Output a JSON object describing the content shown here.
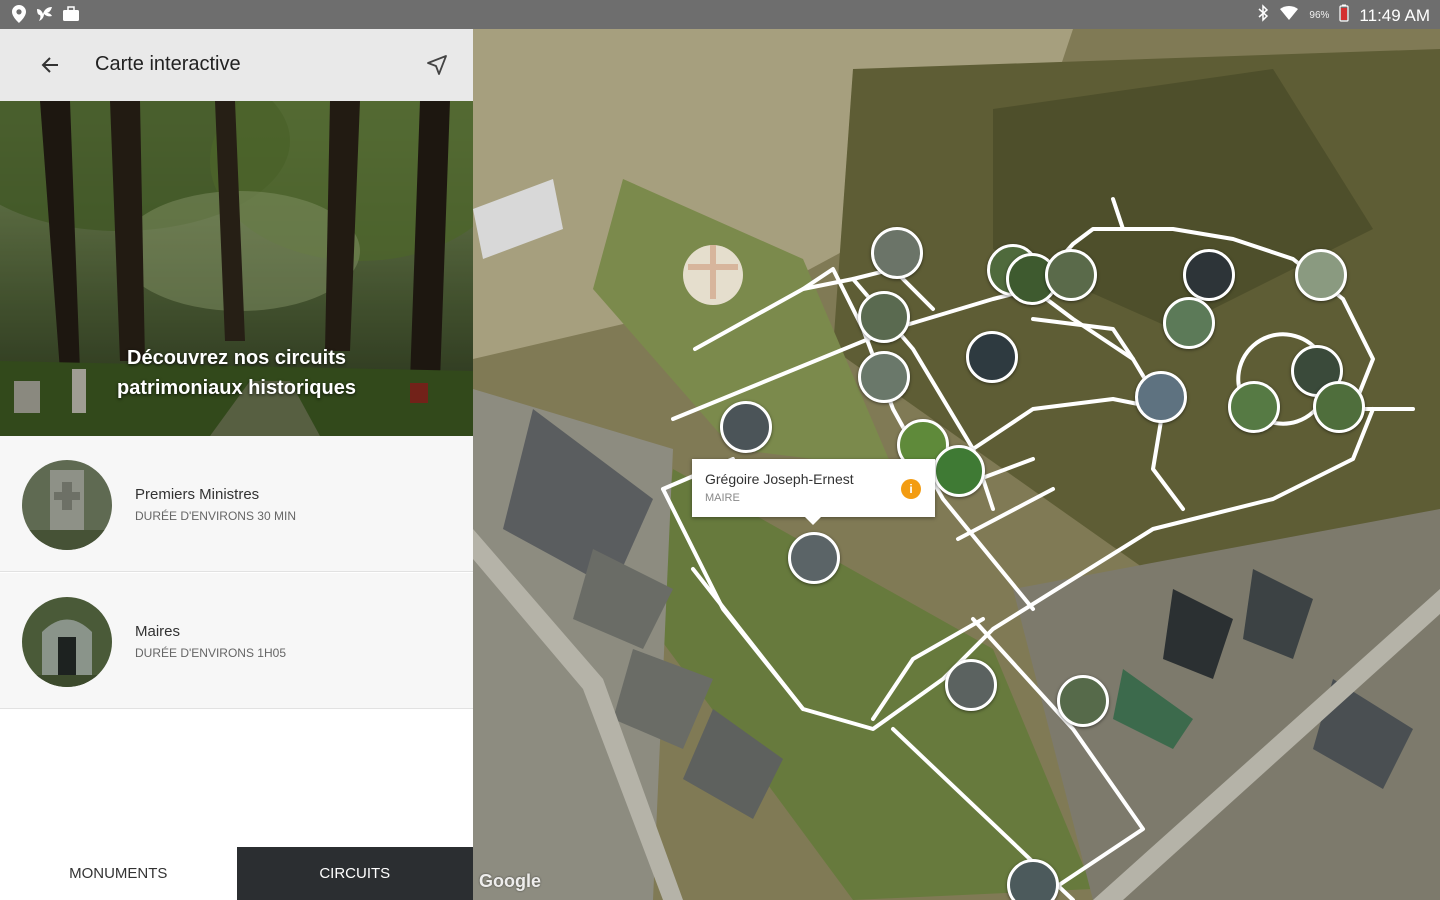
{
  "status_bar": {
    "left_icons": [
      "location-icon",
      "bird-icon",
      "briefcase-icon"
    ],
    "right_icons": [
      "bluetooth-icon",
      "wifi-icon",
      "battery-icon"
    ],
    "battery_percent": "96%",
    "time": "11:49 AM"
  },
  "app_bar": {
    "back_icon": "back-arrow-icon",
    "title": "Carte interactive",
    "navigate_icon": "navigation-icon"
  },
  "hero": {
    "text_line1": "Découvrez nos circuits",
    "text_line2": "patrimoniaux historiques"
  },
  "circuits": [
    {
      "name": "Premiers Ministres",
      "duration": "DURÉE D'ENVIRONS 30 MIN"
    },
    {
      "name": "Maires",
      "duration": "DURÉE D'ENVIRONS 1H05"
    }
  ],
  "tabs": {
    "monuments": "MONUMENTS",
    "circuits": "CIRCUITS",
    "active": "circuits"
  },
  "map": {
    "popup": {
      "name": "Grégoire Joseph-Ernest",
      "role": "MAIRE",
      "info_icon": "info-icon",
      "info_glyph": "i"
    },
    "attribution": "Google",
    "colors": {
      "path": "#ffffff",
      "marker_border": "#ffffff",
      "info_badge": "#f39c12",
      "active_tab": "#2b2e31"
    }
  }
}
